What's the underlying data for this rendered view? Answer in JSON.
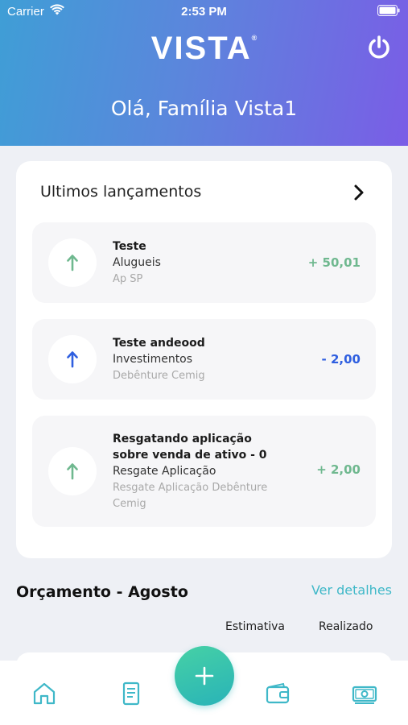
{
  "status_bar": {
    "carrier": "Carrier",
    "time": "2:53 PM"
  },
  "header": {
    "logo": "VISTA",
    "logo_mark": "®",
    "greeting": "Olá, Família Vista1"
  },
  "launches": {
    "title": "Ultimos lançamentos",
    "items": [
      {
        "title": "Teste",
        "category": "Alugueis",
        "subtitle": "Ap SP",
        "amount": "+ 50,01",
        "direction": "up",
        "color": "#6fb88f"
      },
      {
        "title": "Teste andeood",
        "category": "Investimentos",
        "subtitle": "Debênture Cemig",
        "amount": "- 2,00",
        "direction": "up",
        "color": "#2f5fe0"
      },
      {
        "title": "Resgatando aplicação sobre venda de ativo - 0",
        "category": "Resgate Aplicação",
        "subtitle": "Resgate Aplicação Debênture Cemig",
        "amount": "+ 2,00",
        "direction": "up",
        "color": "#6fb88f"
      }
    ]
  },
  "budget": {
    "title": "Orçamento - Agosto",
    "details_link": "Ver detalhes",
    "columns": [
      "Estimativa",
      "Realizado"
    ]
  },
  "tabbar": {
    "icons": [
      "home-icon",
      "document-icon",
      "add-icon",
      "wallet-icon",
      "money-icon"
    ],
    "accent": "#3fb8c8"
  }
}
